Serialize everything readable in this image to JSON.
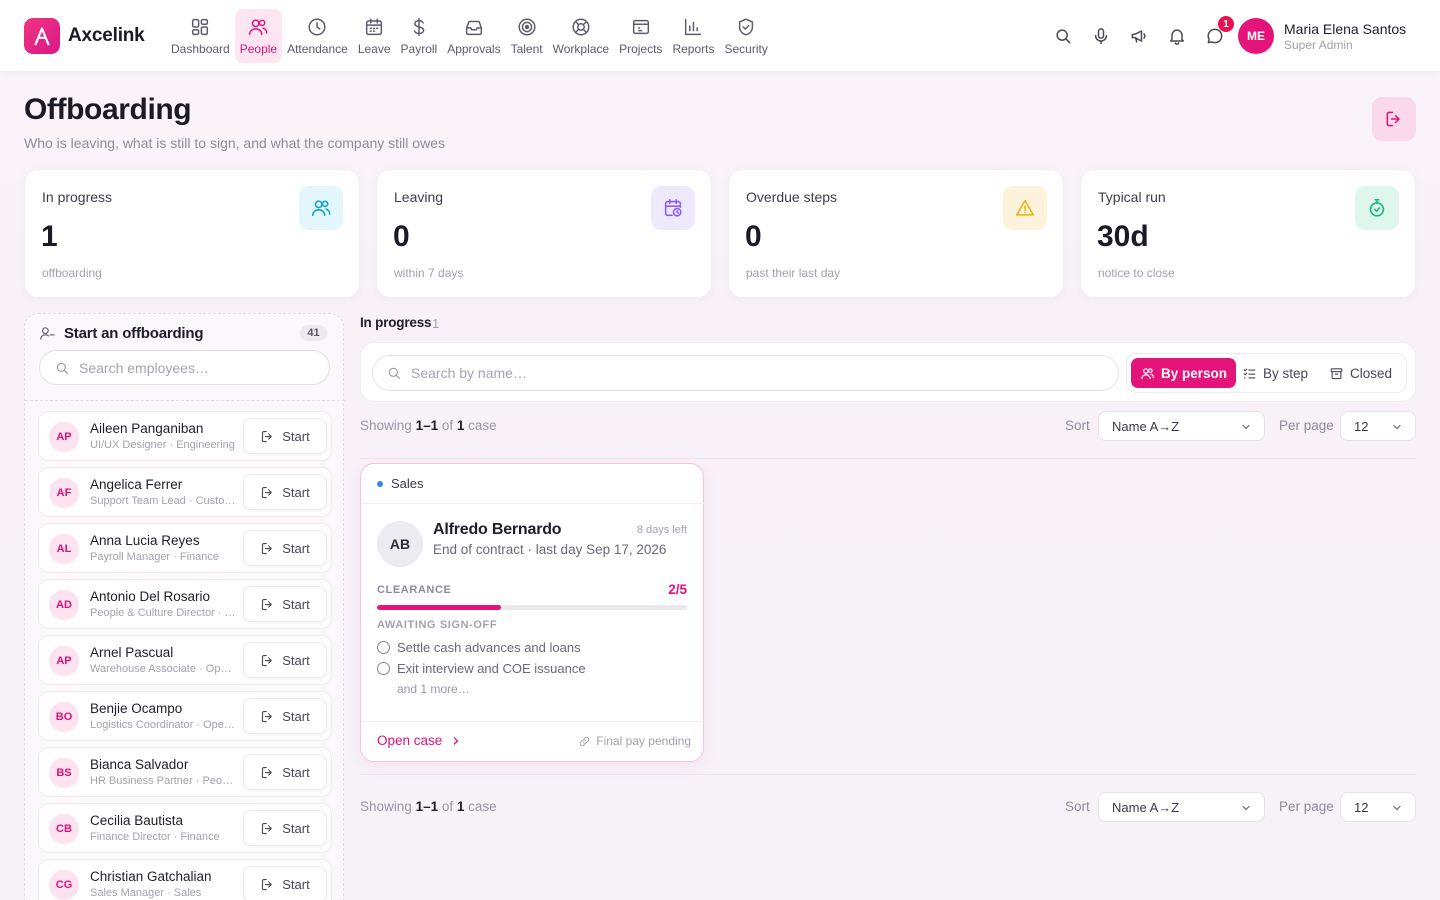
{
  "brand": {
    "name": "Axcelink"
  },
  "nav": [
    {
      "label": "Dashboard",
      "icon": "dashboard-icon"
    },
    {
      "label": "People",
      "icon": "people-icon",
      "active": true
    },
    {
      "label": "Attendance",
      "icon": "clock-icon"
    },
    {
      "label": "Leave",
      "icon": "calendar-icon"
    },
    {
      "label": "Payroll",
      "icon": "dollar-icon"
    },
    {
      "label": "Approvals",
      "icon": "inbox-icon"
    },
    {
      "label": "Talent",
      "icon": "target-icon"
    },
    {
      "label": "Workplace",
      "icon": "lifebuoy-icon"
    },
    {
      "label": "Projects",
      "icon": "folder-icon"
    },
    {
      "label": "Reports",
      "icon": "bar-chart-icon"
    },
    {
      "label": "Security",
      "icon": "shield-icon"
    }
  ],
  "topbar": {
    "notifications_count": "1"
  },
  "user": {
    "initials": "ME",
    "name": "Maria Elena Santos",
    "role": "Super Admin"
  },
  "header": {
    "title": "Offboarding",
    "subtitle": "Who is leaving, what is still to sign, and what the company still owes"
  },
  "stats": [
    {
      "label": "In progress",
      "value": "1",
      "note": "offboarding",
      "icon": "users-icon",
      "color": "#0ea5c6",
      "bg": "#e2f6fb"
    },
    {
      "label": "Leaving",
      "value": "0",
      "note": "within 7 days",
      "icon": "calendar-clock-icon",
      "color": "#8b5cf6",
      "bg": "#efe9fd"
    },
    {
      "label": "Overdue steps",
      "value": "0",
      "note": "past their last day",
      "icon": "warning-icon",
      "color": "#eab308",
      "bg": "#fdf3dc"
    },
    {
      "label": "Typical run",
      "value": "30d",
      "note": "notice to close",
      "icon": "timer-icon",
      "color": "#10b981",
      "bg": "#dff6ec"
    }
  ],
  "start_panel": {
    "title": "Start an offboarding",
    "count": "41",
    "search_placeholder": "Search employees…",
    "start_label": "Start",
    "employees": [
      {
        "initials": "AP",
        "name": "Aileen Panganiban",
        "role": "UI/UX Designer · Engineering"
      },
      {
        "initials": "AF",
        "name": "Angelica Ferrer",
        "role": "Support Team Lead · Customer Success"
      },
      {
        "initials": "AL",
        "name": "Anna Lucia Reyes",
        "role": "Payroll Manager · Finance"
      },
      {
        "initials": "AD",
        "name": "Antonio Del Rosario",
        "role": "People & Culture Director · People"
      },
      {
        "initials": "AP",
        "name": "Arnel Pascual",
        "role": "Warehouse Associate · Operations"
      },
      {
        "initials": "BO",
        "name": "Benjie Ocampo",
        "role": "Logistics Coordinator · Operations"
      },
      {
        "initials": "BS",
        "name": "Bianca Salvador",
        "role": "HR Business Partner · People"
      },
      {
        "initials": "CB",
        "name": "Cecilia Bautista",
        "role": "Finance Director · Finance"
      },
      {
        "initials": "CG",
        "name": "Christian Gatchalian",
        "role": "Sales Manager · Sales"
      }
    ]
  },
  "in_progress": {
    "label": "In progress",
    "count": "1",
    "search_placeholder": "Search by name…",
    "views": [
      {
        "label": "By person",
        "icon": "users-icon",
        "active": true
      },
      {
        "label": "By step",
        "icon": "list-checks-icon"
      },
      {
        "label": "Closed",
        "icon": "archive-icon"
      }
    ],
    "showing_prefix": "Showing",
    "range": "1–1",
    "of": "of",
    "total": "1",
    "unit": "case",
    "sort_label": "Sort",
    "sort_value": "Name A→Z",
    "per_page_label": "Per page",
    "per_page_value": "12"
  },
  "case": {
    "department": "Sales",
    "initials": "AB",
    "name": "Alfredo Bernardo",
    "days_left": "8 days left",
    "detail": "End of contract · last day Sep 17, 2026",
    "clearance_label": "CLEARANCE",
    "clearance_fraction": "2/5",
    "clearance_progress": 0.4,
    "awaiting_label": "AWAITING SIGN-OFF",
    "pending": [
      "Settle cash advances and loans",
      "Exit interview and COE issuance"
    ],
    "more": "and 1 more…",
    "open_label": "Open case",
    "status": "Final pay pending"
  }
}
